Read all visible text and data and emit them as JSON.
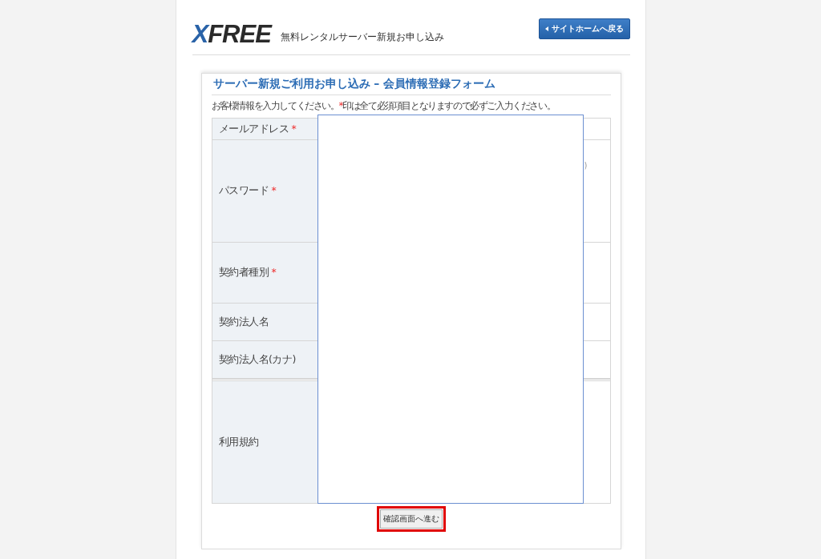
{
  "header": {
    "logo": {
      "x": "X",
      "rest": "FREE"
    },
    "subtitle": "無料レンタルサーバー新規お申し込み",
    "home_button": "サイトホームへ戻る"
  },
  "form": {
    "title": "サーバー新規ご利用お申し込み – 会員情報登録フォーム",
    "intro": {
      "before": "お客様情報を入力してください。",
      "mark": "*",
      "after": "印は全て必須項目となりますので必ずご入力ください。"
    },
    "rows": [
      {
        "label": "メールアドレス",
        "required_mark": "*"
      },
      {
        "label": "パスワード",
        "required_mark": "*",
        "fragment": ")"
      },
      {
        "label": "契約者種別",
        "required_mark": "*"
      },
      {
        "label": "契約法人名"
      },
      {
        "label": "契約法人名(カナ)"
      },
      {
        "label": "利用規約"
      }
    ],
    "submit": "確認画面へ進む"
  }
}
